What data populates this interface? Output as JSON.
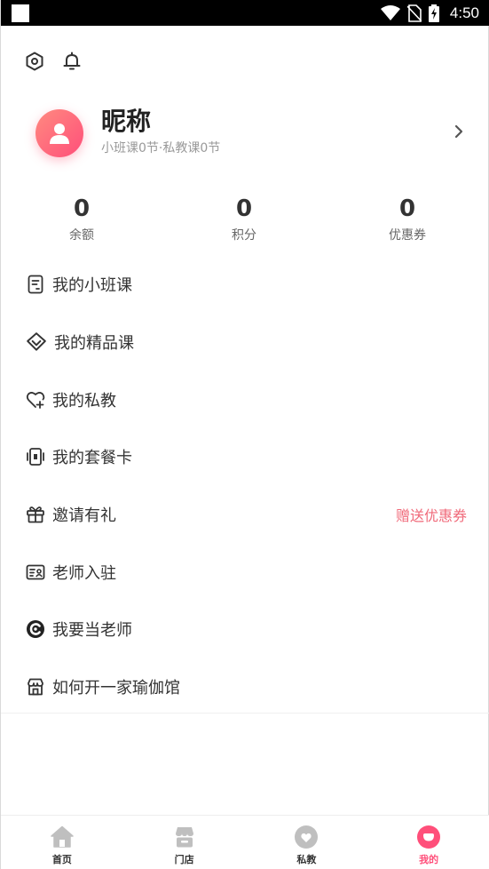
{
  "status_bar": {
    "time": "4:50"
  },
  "profile": {
    "nickname": "昵称",
    "class_info": "小班课0节·私教课0节"
  },
  "stats": [
    {
      "value": "0",
      "label": "余额"
    },
    {
      "value": "0",
      "label": "积分"
    },
    {
      "value": "0",
      "label": "优惠券"
    }
  ],
  "menu": [
    {
      "label": "我的小班课",
      "icon": "document-icon"
    },
    {
      "label": "我的精品课",
      "icon": "diamond-icon"
    },
    {
      "label": "我的私教",
      "icon": "heart-plus-icon"
    },
    {
      "label": "我的套餐卡",
      "icon": "card-icon"
    },
    {
      "label": "邀请有礼",
      "icon": "gift-icon",
      "extra": "赠送优惠券"
    },
    {
      "label": "老师入驻",
      "icon": "id-card-icon"
    },
    {
      "label": "我要当老师",
      "icon": "c-logo-icon"
    },
    {
      "label": "如何开一家瑜伽馆",
      "icon": "store-icon"
    }
  ],
  "tabs": [
    {
      "label": "首页",
      "icon": "home-icon"
    },
    {
      "label": "门店",
      "icon": "shop-icon"
    },
    {
      "label": "私教",
      "icon": "heart-circle-icon"
    },
    {
      "label": "我的",
      "icon": "profile-icon",
      "active": true
    }
  ],
  "colors": {
    "accent": "#ff4f7a",
    "highlight_text": "#f06a7a",
    "tab_inactive_icon": "#bfbfbf"
  }
}
